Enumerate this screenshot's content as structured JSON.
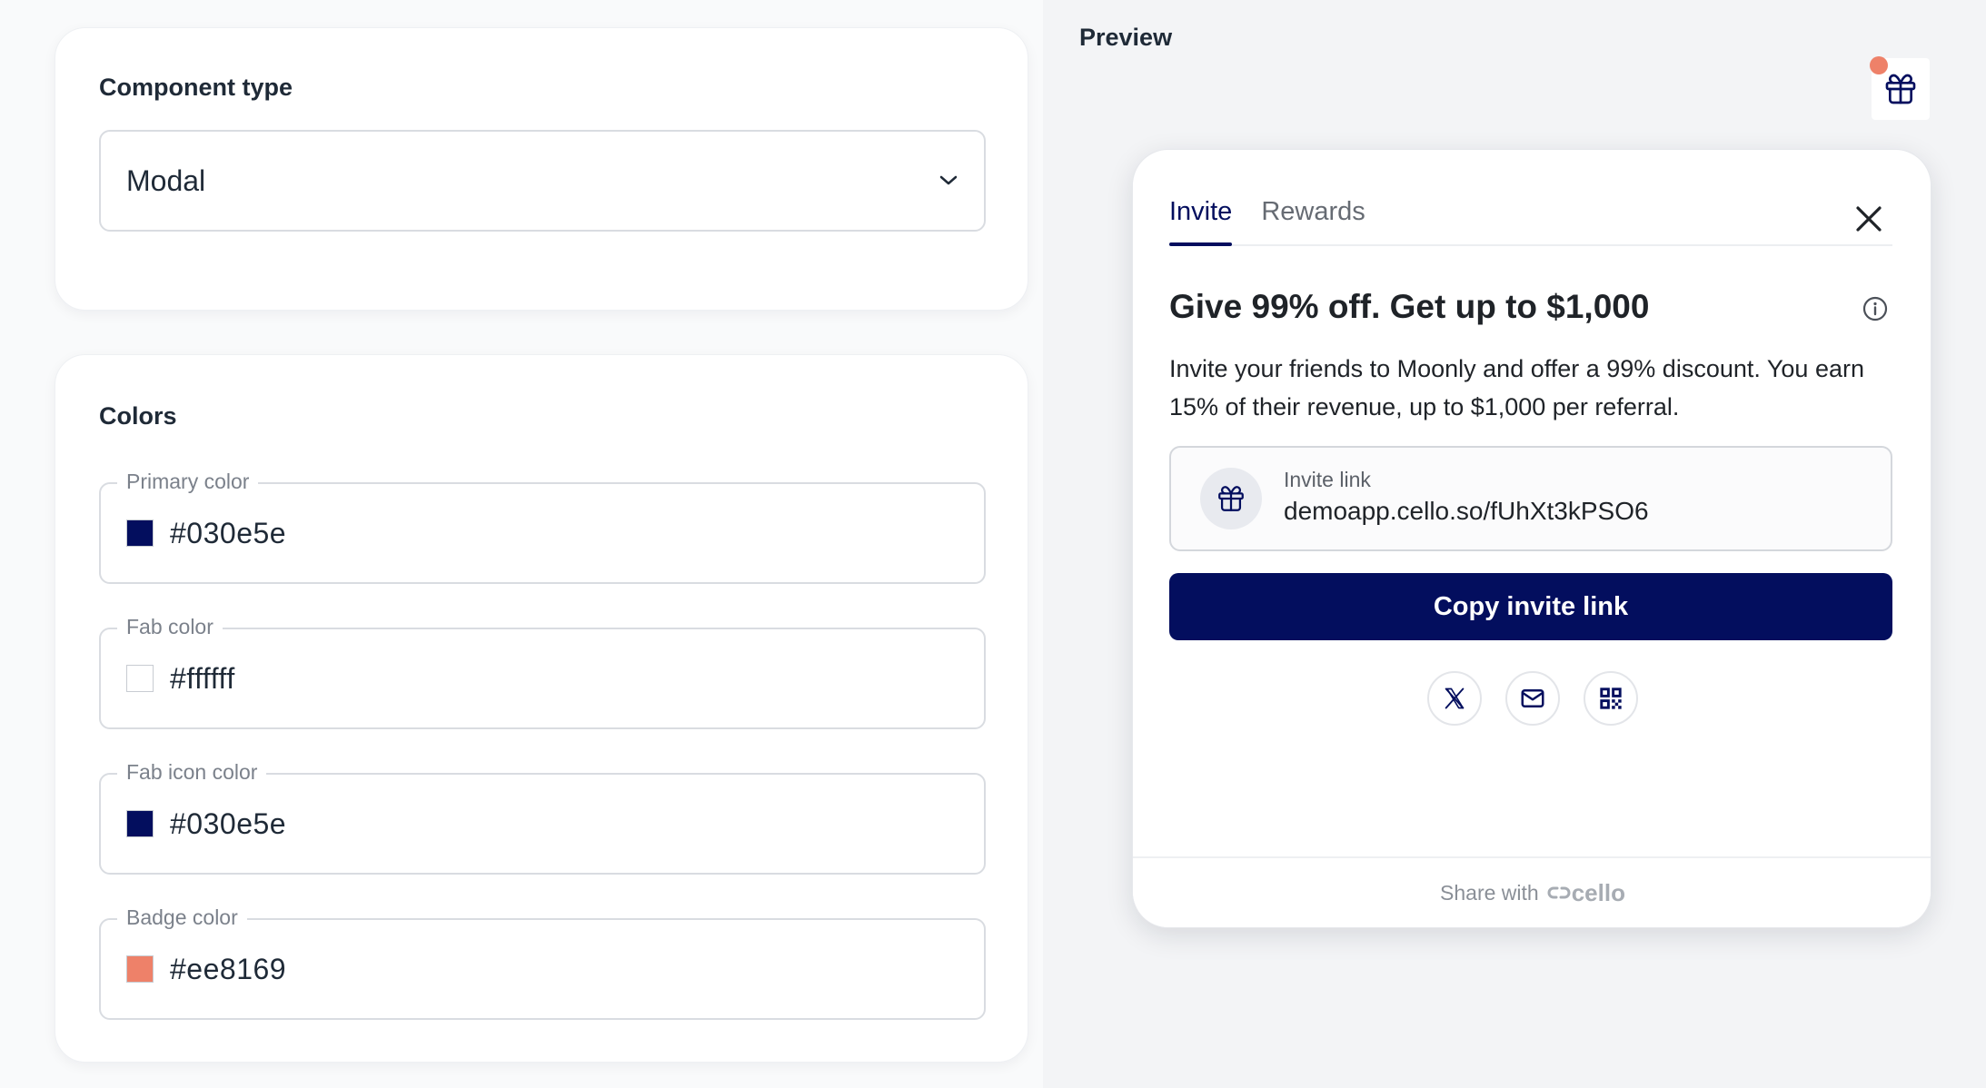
{
  "component": {
    "title": "Component type",
    "selected": "Modal"
  },
  "colors": {
    "title": "Colors",
    "fields": [
      {
        "label": "Primary color",
        "value": "#030e5e",
        "swatch": "#030e5e"
      },
      {
        "label": "Fab color",
        "value": "#ffffff",
        "swatch": "#ffffff"
      },
      {
        "label": "Fab icon color",
        "value": "#030e5e",
        "swatch": "#030e5e"
      },
      {
        "label": "Badge color",
        "value": "#ee8169",
        "swatch": "#ee8169"
      }
    ]
  },
  "preview": {
    "label": "Preview",
    "fab_icon": "gift-icon",
    "badge_color": "#ee8169",
    "modal": {
      "tabs": [
        {
          "label": "Invite",
          "active": true
        },
        {
          "label": "Rewards",
          "active": false
        }
      ],
      "headline": "Give 99% off. Get up to $1,000",
      "description": "Invite your friends to Moonly and offer a 99% discount. You earn 15% of their revenue, up to $1,000 per referral.",
      "invite_label": "Invite link",
      "invite_link": "demoapp.cello.so/fUhXt3kPSO6",
      "copy_button": "Copy invite link",
      "share_icons": [
        "x-icon",
        "email-icon",
        "qr-code-icon"
      ],
      "footer_text": "Share with",
      "footer_brand": "cello"
    }
  }
}
